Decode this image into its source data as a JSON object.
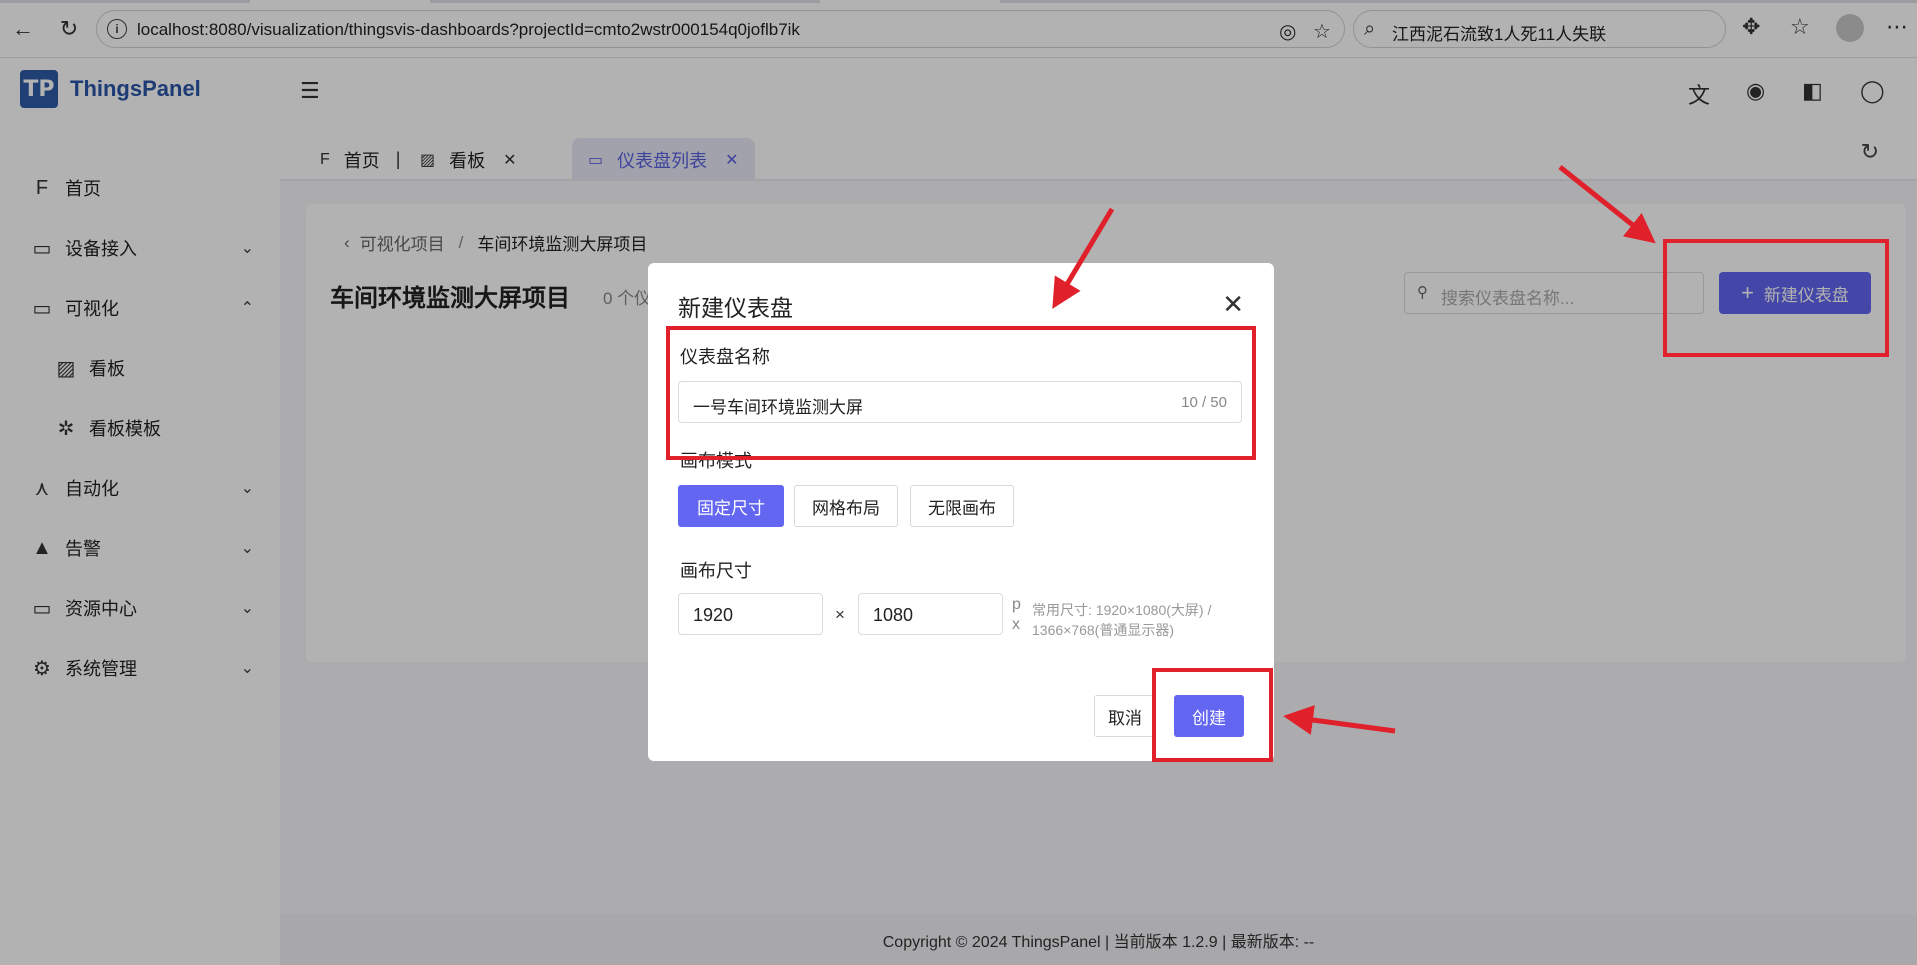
{
  "browser": {
    "url": "localhost:8080/visualization/thingsvis-dashboards?projectId=cmto2wstr000154q0joflb7ik",
    "search_text": "江西泥石流致1人死11人失联",
    "icons": [
      "back-icon",
      "reload-icon",
      "info-icon",
      "copilot-icon",
      "star-icon",
      "search-icon",
      "extensions-icon",
      "favorites-icon",
      "profile-icon"
    ]
  },
  "app": {
    "logo_mark": "TP",
    "logo_text": "ThingsPanel"
  },
  "sidebar": {
    "items": [
      {
        "label": "首页",
        "icon": "home-icon",
        "glyph": "F"
      },
      {
        "label": "设备接入",
        "icon": "monitor-icon",
        "glyph": "▭"
      },
      {
        "label": "可视化",
        "icon": "display-icon",
        "glyph": "▭"
      },
      {
        "label": "看板",
        "icon": "dashboard-icon",
        "glyph": "▨"
      },
      {
        "label": "看板模板",
        "icon": "puzzle-icon",
        "glyph": "✲"
      },
      {
        "label": "自动化",
        "icon": "automation-icon",
        "glyph": "⋏"
      },
      {
        "label": "告警",
        "icon": "warning-icon",
        "glyph": "▲"
      },
      {
        "label": "资源中心",
        "icon": "resource-icon",
        "glyph": "▭"
      },
      {
        "label": "系统管理",
        "icon": "system-settings-icon",
        "glyph": "⚙"
      }
    ]
  },
  "tabs": [
    {
      "label": "首页",
      "icon": "home-icon"
    },
    {
      "label": "看板",
      "icon": "dashboard-icon"
    },
    {
      "label": "仪表盘列表",
      "icon": "monitor-icon"
    }
  ],
  "page": {
    "breadcrumb_parent": "可视化项目",
    "breadcrumb_sep": "/",
    "breadcrumb_current": "车间环境监测大屏项目",
    "title": "车间环境监测大屏项目",
    "subtitle": "0 个仪",
    "search_placeholder": "搜索仪表盘名称...",
    "new_button": "新建仪表盘"
  },
  "modal": {
    "title": "新建仪表盘",
    "name_label": "仪表盘名称",
    "name_value": "一号车间环境监测大屏",
    "name_count": "10 / 50",
    "mode_label": "画布模式",
    "modes": [
      "固定尺寸",
      "网格布局",
      "无限画布"
    ],
    "selected_mode": "固定尺寸",
    "size_label": "画布尺寸",
    "width": "1920",
    "height": "1080",
    "times": "×",
    "unit_p": "p",
    "unit_x": "x",
    "size_hint": "常用尺寸: 1920×1080(大屏) / 1366×768(普通显示器)",
    "cancel": "取消",
    "create": "创建"
  },
  "footer": {
    "text": "Copyright © 2024 ThingsPanel | 当前版本 1.2.9 | 最新版本: --"
  },
  "colors": {
    "primary": "#6366f1",
    "annotation": "#e0202a",
    "brand": "#2a55a6"
  }
}
